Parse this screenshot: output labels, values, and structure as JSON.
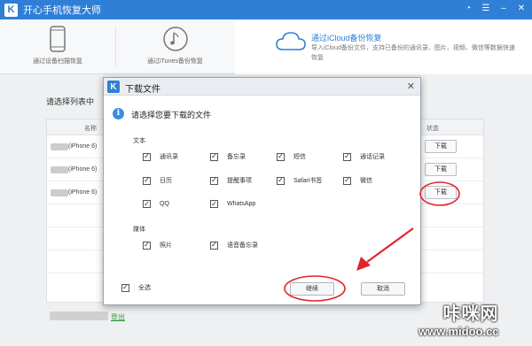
{
  "app": {
    "title": "开心手机恢复大师"
  },
  "nav": {
    "items": [
      {
        "label": "通过设备扫描恢复"
      },
      {
        "label": "通过iTunes备份恢复"
      }
    ],
    "active": {
      "title": "通过iCloud备份恢复",
      "desc": "导入iCloud备份文件，支持已备份的通讯录、图片、视频、微信等数据快速恢复"
    }
  },
  "main": {
    "label": "请选择列表中",
    "columns": [
      "名称",
      "状态"
    ],
    "rows": [
      {
        "device": "(iPhone 6)",
        "action": "下载"
      },
      {
        "device": "(iPhone 6)",
        "action": "下载"
      },
      {
        "device": "(iPhone 6)",
        "action": "下载"
      }
    ],
    "logout": "登出"
  },
  "dialog": {
    "title": "下载文件",
    "prompt": "请选择您要下载的文件",
    "text_section": "文本",
    "media_section": "媒体",
    "text_options": [
      "通讯录",
      "备忘录",
      "短信",
      "通话记录",
      "日历",
      "提醒事项",
      "Safari书签",
      "微信",
      "QQ",
      "WhatsApp"
    ],
    "media_options": [
      "照片",
      "语音备忘录"
    ],
    "select_all": "全选",
    "continue": "继续",
    "cancel": "取消"
  },
  "watermark": {
    "line1": "咔咪网",
    "line2": "www.midoo.cc"
  },
  "colors": {
    "brand": "#2f7fd6",
    "annotation": "#e0252a",
    "link": "#2c9a3a"
  }
}
